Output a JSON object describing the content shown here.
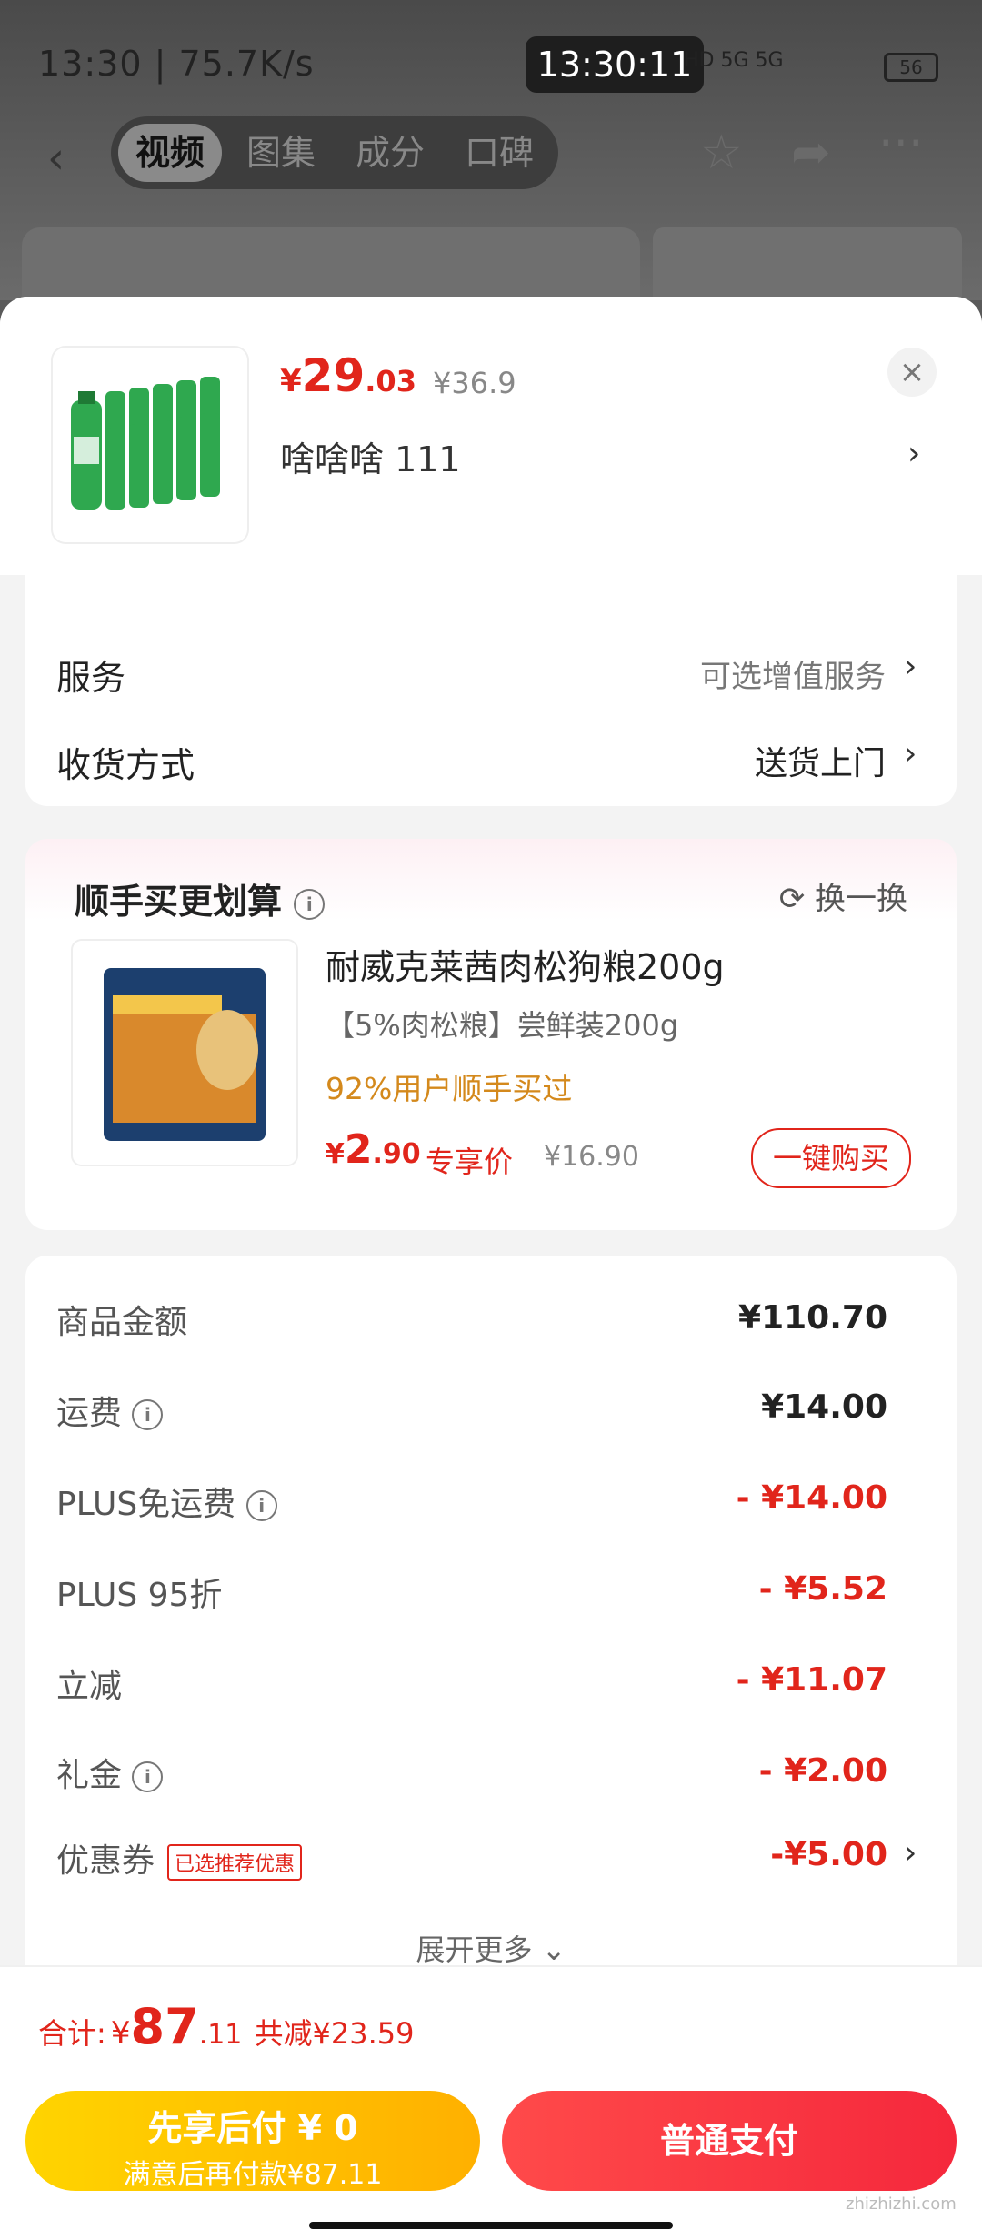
{
  "status_bar": {
    "left_text": "13:30 | 75.7K/s",
    "clock": "13:30:11",
    "network": "HD 5G 5G",
    "battery": "56"
  },
  "nav": {
    "tabs": [
      "视频",
      "图集",
      "成分",
      "口碑"
    ],
    "active_tab": 0
  },
  "product": {
    "price_symbol": "¥",
    "price_int": "29",
    "price_dec": ".03",
    "original_price": "¥36.9",
    "variant": "啥啥啥  111",
    "close": "×"
  },
  "options": {
    "service_label": "服务",
    "service_value": "可选增值服务",
    "delivery_label": "收货方式",
    "delivery_value": "送货上门"
  },
  "addon": {
    "title": "顺手买更划算",
    "refresh": "换一换",
    "name": "耐威克莱茜肉松狗粮200g",
    "subtitle": "【5%肉松粮】尝鲜装200g",
    "rate": "92%用户顺手买过",
    "price_symbol": "¥",
    "price_int": "2",
    "price_dec": ".90",
    "price_tag": "专享价",
    "original_price": "¥16.90",
    "buy_label": "一键购买"
  },
  "summary": {
    "rows": [
      {
        "label": "商品金额",
        "value": "¥110.70",
        "red": false,
        "info": false
      },
      {
        "label": "运费",
        "value": "¥14.00",
        "red": false,
        "info": true
      },
      {
        "label": "PLUS免运费",
        "value": "- ¥14.00",
        "red": true,
        "info": true
      },
      {
        "label": "PLUS 95折",
        "value": "- ¥5.52",
        "red": true,
        "info": false
      },
      {
        "label": "立减",
        "value": "- ¥11.07",
        "red": true,
        "info": false
      },
      {
        "label": "礼金",
        "value": "- ¥2.00",
        "red": true,
        "info": true
      },
      {
        "label": "优惠券",
        "value": "-¥5.00",
        "red": true,
        "info": false
      }
    ],
    "coupon_badge": "已选推荐优惠",
    "expand": "展开更多"
  },
  "footer": {
    "total_label": "合计:",
    "total_symbol": "¥",
    "total_int": "87",
    "total_dec": ".11",
    "saved": "共减¥23.59",
    "later_title": "先享后付 ¥ 0",
    "later_sub": "满意后再付款¥87.11",
    "pay_label": "普通支付",
    "watermark": "zhizhizhi.com"
  },
  "colors": {
    "accent": "#e1251b",
    "later_btn": "#ffc000",
    "pay_btn": "#f5283c"
  }
}
